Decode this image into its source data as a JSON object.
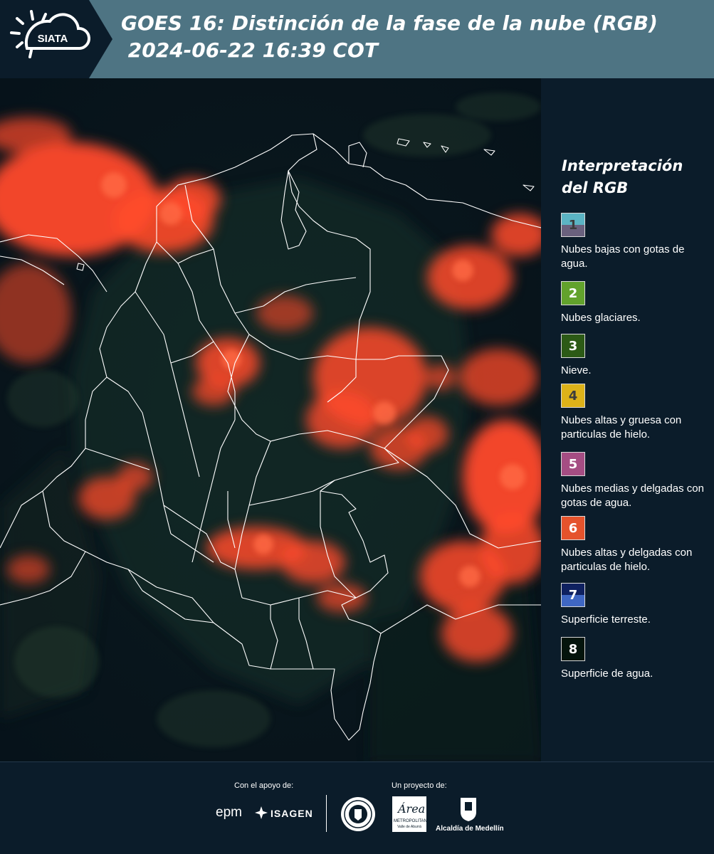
{
  "header": {
    "logo_text": "SIATA",
    "title": "GOES 16: Distinción de la fase de la nube (RGB)\n 2024-06-22 16:39 COT"
  },
  "legend": {
    "title": "Interpretación del RGB",
    "items": [
      {
        "number": "1",
        "label": "Nubes bajas con gotas de agua.",
        "color_top": "#5bb4c4",
        "color_bottom": "#6a617e",
        "number_color": "#3c3c3c"
      },
      {
        "number": "2",
        "label": "Nubes glaciares.",
        "color": "#62a22c",
        "number_color": "#ffffff"
      },
      {
        "number": "3",
        "label": "Nieve.",
        "color": "#2c5a16",
        "number_color": "#ffffff"
      },
      {
        "number": "4",
        "label": "Nubes altas y gruesa con particulas de hielo.",
        "color": "#ddb219",
        "number_color": "#3c3c3c"
      },
      {
        "number": "5",
        "label": "Nubes medias y delgadas con gotas de agua.",
        "color": "#a54d83",
        "number_color": "#ffffff"
      },
      {
        "number": "6",
        "label": "Nubes altas y delgadas con particulas de hielo.",
        "color": "#e5532c",
        "number_color": "#ffffff"
      },
      {
        "number": "7",
        "label": "Superficie terreste.",
        "color_top": "#0f2160",
        "color_bottom": "#3f67c3",
        "number_color": "#ffffff"
      },
      {
        "number": "8",
        "label": "Superficie de agua.",
        "color": "#04140c",
        "number_color": "#ffffff"
      }
    ]
  },
  "footer": {
    "support_label": "Con el apoyo de:",
    "project_label": "Un proyecto de:",
    "sponsor_epm": "epm",
    "sponsor_isagen": "ISAGEN",
    "area_metro_title": "Área",
    "area_metro_sub": "METROPOLITANA",
    "area_metro_sub2": "Valle de Aburrá",
    "alcaldia": "Alcaldía de Medellín"
  },
  "colors": {
    "header_bg": "#4e7483",
    "page_bg": "#0b1c2a",
    "cloud_red": "#ff4a2a",
    "border_white": "#ffffff"
  }
}
